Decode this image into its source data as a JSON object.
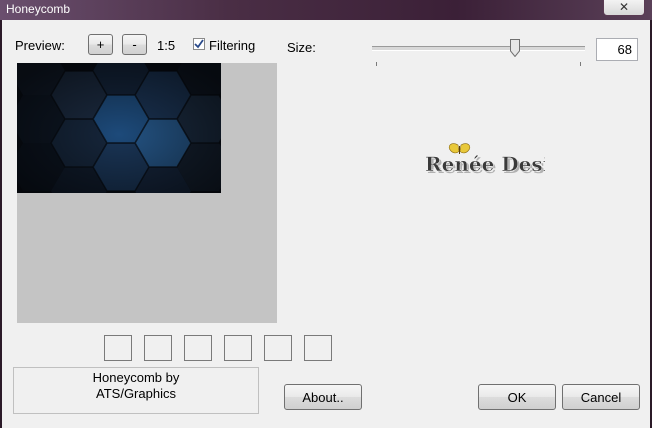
{
  "window": {
    "title": "Honeycomb",
    "close_icon": "close-icon"
  },
  "preview": {
    "label": "Preview:",
    "zoom_in_label": "+",
    "zoom_out_label": "-",
    "zoom_level": "1:5",
    "filtering_label": "Filtering",
    "filtering_checked": true
  },
  "size": {
    "label": "Size:",
    "value": "68",
    "slider_fraction": 0.67
  },
  "logo": {
    "text": "Renée Design"
  },
  "credits": {
    "line1": "Honeycomb by",
    "line2": "ATS/Graphics"
  },
  "buttons": {
    "about": "About..",
    "ok": "OK",
    "cancel": "Cancel"
  },
  "colors": {
    "title_bar": "#4a2e45",
    "preview_bg": "#c4c4c4",
    "hex_dark": "#0f1a2a",
    "hex_blue": "#1d4a7a"
  }
}
